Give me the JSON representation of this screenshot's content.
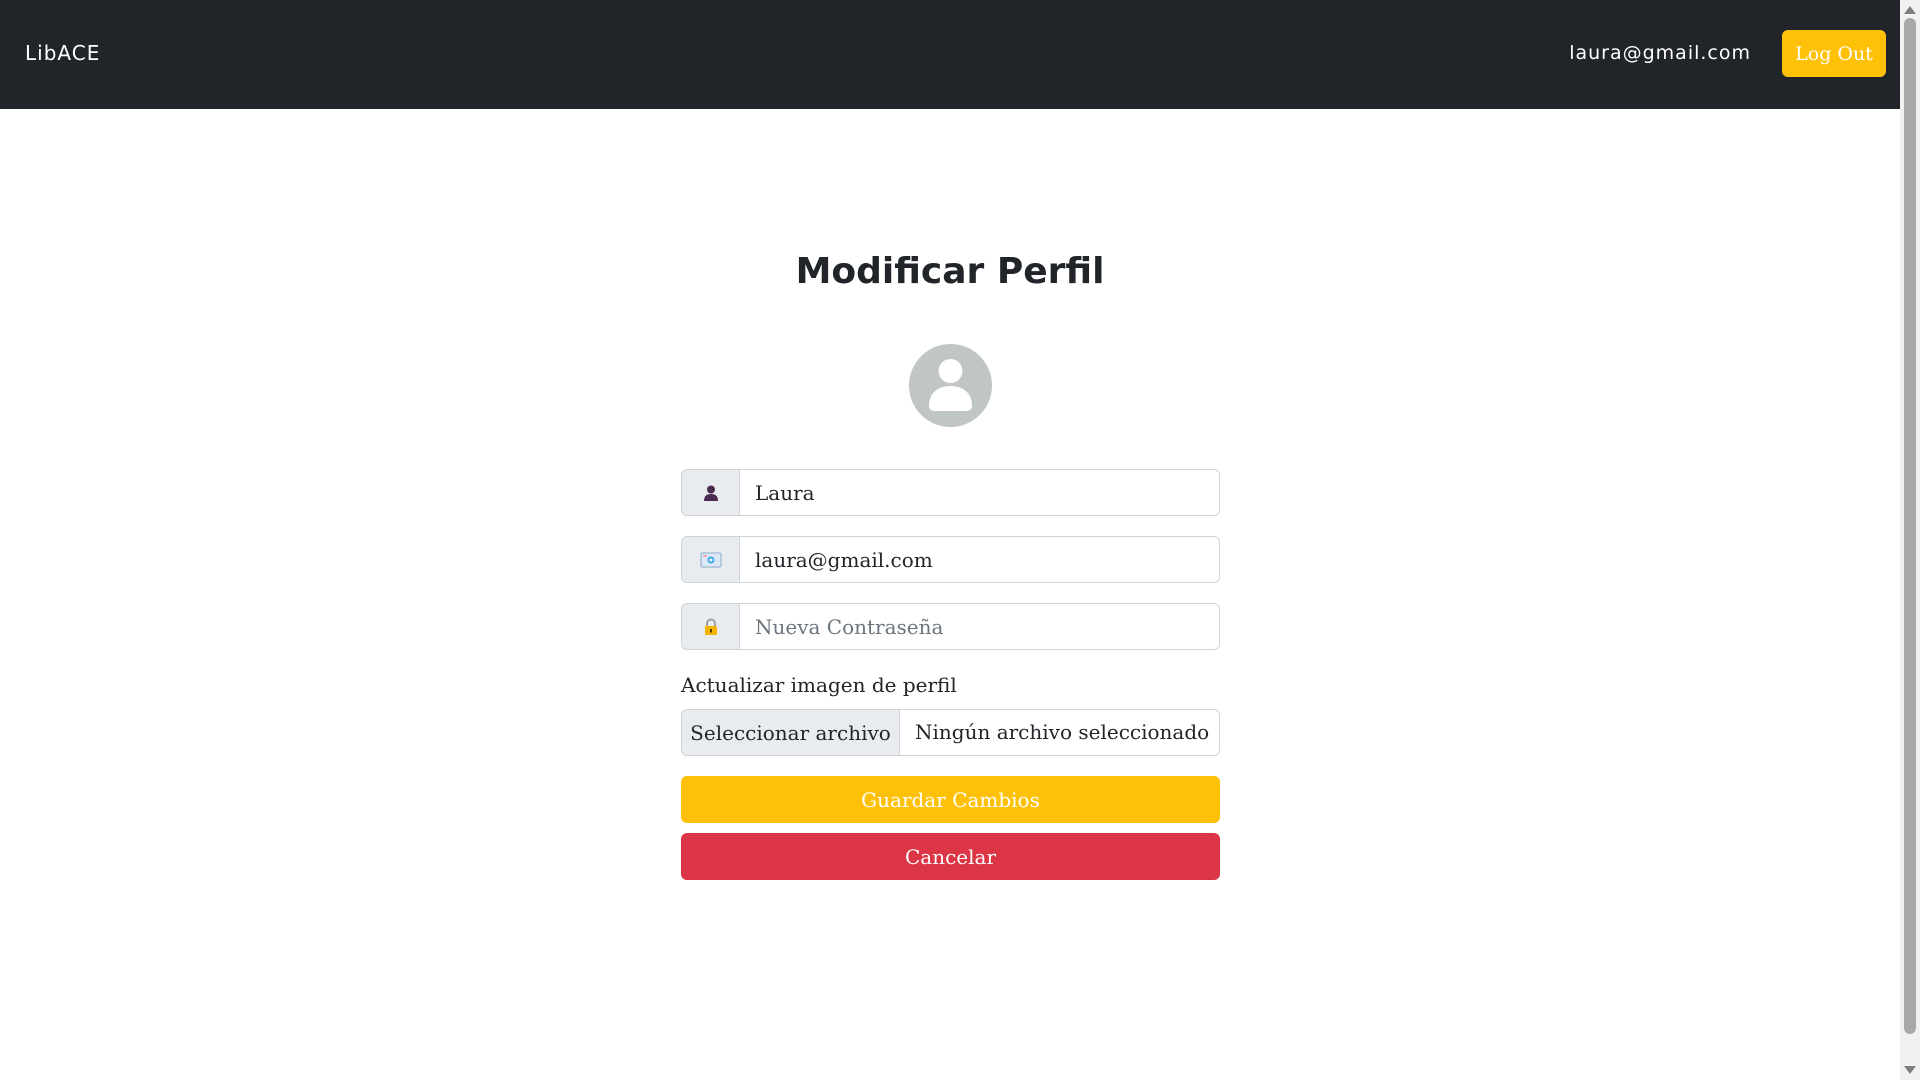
{
  "navbar": {
    "brand": "LibACE",
    "user_email": "laura@gmail.com",
    "logout_label": "Log Out"
  },
  "page": {
    "title": "Modificar Perfil",
    "avatar_icon": "user-avatar-icon"
  },
  "form": {
    "name": {
      "icon": "user-icon",
      "value": "Laura",
      "placeholder": ""
    },
    "email": {
      "icon": "email-icon",
      "value": "laura@gmail.com",
      "placeholder": ""
    },
    "password": {
      "icon": "lock-icon",
      "value": "",
      "placeholder": "Nueva Contraseña"
    },
    "file_label": "Actualizar imagen de perfil",
    "file_button_label": "Seleccionar archivo",
    "file_status": "Ningún archivo seleccionado",
    "save_label": "Guardar Cambios",
    "cancel_label": "Cancelar"
  },
  "colors": {
    "navbar_bg": "#212529",
    "accent_yellow": "#ffc107",
    "danger_red": "#dc3545",
    "input_addon_bg": "#e9ecef"
  }
}
